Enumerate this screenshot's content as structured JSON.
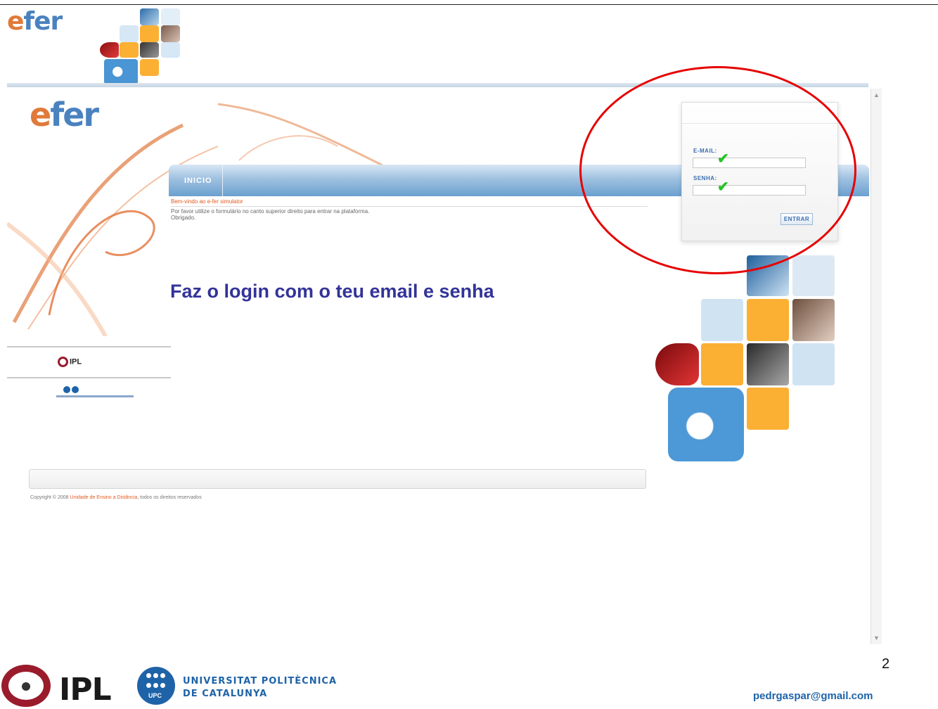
{
  "slide": {
    "logo": {
      "e": "e",
      "rest": "fer"
    },
    "page_number": "2",
    "contact_email": "pedrgaspar@gmail.com",
    "ipl_label": "IPL",
    "upc_label": "UPC",
    "university_name_line1": "UNIVERSITAT POLITÈCNICA",
    "university_name_line2": "DE CATALUNYA"
  },
  "site": {
    "logo": {
      "e": "e",
      "rest": "fer"
    },
    "nav": {
      "tab_inicio": "INICIO"
    },
    "welcome": {
      "title": "Bem-vindo ao e-fer simulator",
      "line1": "Por favor utilize o formulário no canto superior direito para entrar na plataforma.",
      "line2": "Obrigado."
    },
    "ipl_small": "IPL",
    "login": {
      "email_label": "E-MAIL:",
      "email_value": "",
      "password_label": "SENHA:",
      "password_value": "",
      "submit_label": "ENTRAR"
    },
    "copyright": {
      "prefix": "Copyright © 2008 ",
      "link": "Unidade de Ensino a Distância",
      "suffix": ", todos os direitos reservados"
    }
  },
  "annotation": {
    "instruction": "Faz o login com o teu email e senha",
    "check_mark": "✔"
  },
  "colors": {
    "brand_blue": "#4a82bf",
    "brand_orange": "#e07a3a",
    "tile_orange": "#fbb034",
    "tile_blue": "#cfe3f3",
    "callout_red": "#e60000",
    "instruction_blue": "#333399"
  }
}
